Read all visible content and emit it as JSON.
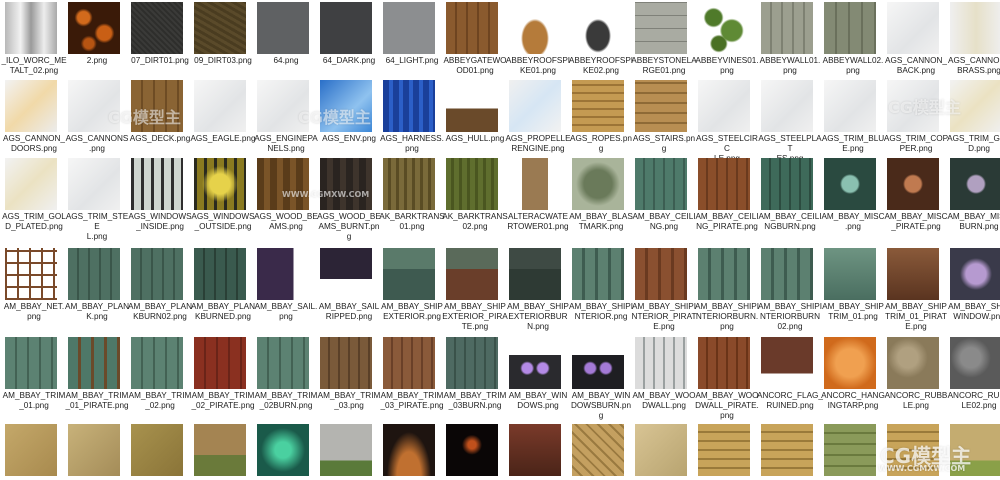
{
  "watermark": {
    "text": "CG模型主",
    "url": "WWW.CGMXW.COM"
  },
  "rows": [
    [
      {
        "label": "_ILO_WORC_ME\nTALT_02.png",
        "tex": "chrome"
      },
      {
        "label": "2.png",
        "tex": "lava"
      },
      {
        "label": "07_DIRT01.png",
        "tex": "darkdirt"
      },
      {
        "label": "09_DIRT03.png",
        "tex": "browndirt"
      },
      {
        "label": "64.png",
        "tex": "gray"
      },
      {
        "label": "64_DARK.png",
        "tex": "darkgray"
      },
      {
        "label": "64_LIGHT.png",
        "tex": "lightgray"
      },
      {
        "label": "ABBEYGATEWO\nOD01.png",
        "tex": "woodgate"
      },
      {
        "label": "ABBEYROOFSPI\nKE01.png",
        "tex": "spike1"
      },
      {
        "label": "ABBEYROOFSPI\nKE02.png",
        "tex": "spike2"
      },
      {
        "label": "ABBEYSTONELA\nRGE01.png",
        "tex": "stone"
      },
      {
        "label": "ABBEYVINES01.\npng",
        "tex": "vines"
      },
      {
        "label": "ABBEYWALL01.\npng",
        "tex": "wall1"
      },
      {
        "label": "ABBEYWALL02.\npng",
        "tex": "wall2"
      },
      {
        "label": "AGS_CANNON_\nBACK.png",
        "tex": "white"
      },
      {
        "label": "AGS_CANNON_\nBRASS.png",
        "tex": "whiteglow"
      }
    ],
    [
      {
        "label": "AGS_CANNON_\nDOORS.png",
        "tex": "whiteorange"
      },
      {
        "label": "AGS_CANNONS\n.png",
        "tex": "white"
      },
      {
        "label": "AGS_DECK.png",
        "tex": "deck"
      },
      {
        "label": "AGS_EAGLE.png",
        "tex": "white"
      },
      {
        "label": "AGS_ENGINEPA\nNELS.png",
        "tex": "white"
      },
      {
        "label": "AGS_ENV.png",
        "tex": "blue"
      },
      {
        "label": "AGS_HARNESS.\npng",
        "tex": "harness"
      },
      {
        "label": "AGS_HULL.png",
        "tex": "hull"
      },
      {
        "label": "AGS_PROPELLE\nRENGINE.png",
        "tex": "whiteblue"
      },
      {
        "label": "AGS_ROPES.pn\ng",
        "tex": "ropes"
      },
      {
        "label": "AGS_STAIRS.pn\ng",
        "tex": "stairs"
      },
      {
        "label": "AGS_STEELCIRC\nLE.png",
        "tex": "white"
      },
      {
        "label": "AGS_STEELPLAT\nES.png",
        "tex": "white"
      },
      {
        "label": "AGS_TRIM_BLU\nE.png",
        "tex": "white"
      },
      {
        "label": "AGS_TRIM_COP\nPER.png",
        "tex": "white"
      },
      {
        "label": "AGS_TRIM_GOL\nD.png",
        "tex": "whitegold"
      }
    ],
    [
      {
        "label": "AGS_TRIM_GOL\nD_PLATED.png",
        "tex": "whitegold"
      },
      {
        "label": "AGS_TRIM_STEE\nL.png",
        "tex": "white"
      },
      {
        "label": "AGS_WINDOWS\n_INSIDE.png",
        "tex": "winInside"
      },
      {
        "label": "AGS_WINDOWS\n_OUTSIDE.png",
        "tex": "winOutside"
      },
      {
        "label": "AGS_WOOD_BE\nAMS.png",
        "tex": "woodbeam"
      },
      {
        "label": "AGS_WOOD_BE\nAMS_BURNT.pn\ng",
        "tex": "woodburnt"
      },
      {
        "label": "AK_BARKTRANS\n01.png",
        "tex": "bark1"
      },
      {
        "label": "AK_BARKTRANS\n02.png",
        "tex": "bark2"
      },
      {
        "label": "ALTERACWATE\nRTOWER01.png",
        "tex": "tower"
      },
      {
        "label": "AM_BBAY_BLAS\nTMARK.png",
        "tex": "blast"
      },
      {
        "label": "AM_BBAY_CEILI\nNG.png",
        "tex": "greenwood"
      },
      {
        "label": "AM_BBAY_CEILI\nNG_PIRATE.png",
        "tex": "redwood"
      },
      {
        "label": "AM_BBAY_CEILI\nNGBURN.png",
        "tex": "greenwooddark"
      },
      {
        "label": "AM_BBAY_MISC\n.png",
        "tex": "misc"
      },
      {
        "label": "AM_BBAY_MISC\n_PIRATE.png",
        "tex": "miscred"
      },
      {
        "label": "AM_BBAY_MISC\nBURN.png",
        "tex": "miscburn"
      }
    ],
    [
      {
        "label": "AM_BBAY_NET.\npng",
        "tex": "net"
      },
      {
        "label": "AM_BBAY_PLAN\nK.png",
        "tex": "greenplank"
      },
      {
        "label": "AM_BBAY_PLAN\nKBURN02.png",
        "tex": "greenplank"
      },
      {
        "label": "AM_BBAY_PLAN\nKBURNED.png",
        "tex": "greenplankdark"
      },
      {
        "label": "AM_BBAY_SAIL.\npng",
        "tex": "sail"
      },
      {
        "label": "AM_BBAY_SAIL\nRIPPED.png",
        "tex": "sailripped"
      },
      {
        "label": "AM_BBAY_SHIP\nEXTERIOR.png",
        "tex": "shipext"
      },
      {
        "label": "AM_BBAY_SHIP\nEXTERIOR_PIRA\nTE.png",
        "tex": "shipextred"
      },
      {
        "label": "AM_BBAY_SHIP\nEXTERIORBUR\nN.png",
        "tex": "shipextburn"
      },
      {
        "label": "AM_BBAY_SHIPI\nNTERIOR.png",
        "tex": "shipint"
      },
      {
        "label": "AM_BBAY_SHIPI\nNTERIOR_PIRAT\nE.png",
        "tex": "shipintred"
      },
      {
        "label": "AM_BBAY_SHIPI\nNTERIORBURN.\npng",
        "tex": "shipint"
      },
      {
        "label": "AM_BBAY_SHIPI\nNTERIORBURN\n02.png",
        "tex": "shipint"
      },
      {
        "label": "AM_BBAY_SHIP\nTRIM_01.png",
        "tex": "shiptrim"
      },
      {
        "label": "AM_BBAY_SHIP\nTRIM_01_PIRAT\nE.png",
        "tex": "shiptrimred"
      },
      {
        "label": "AM_BBAY_SHIP\nWINDOW.png",
        "tex": "shipwindow"
      }
    ],
    [
      {
        "label": "AM_BBAY_TRIM\n_01.png",
        "tex": "trimgreen"
      },
      {
        "label": "AM_BBAY_TRIM\n_01_PIRATE.png",
        "tex": "trimgreen2"
      },
      {
        "label": "AM_BBAY_TRIM\n_02.png",
        "tex": "trimgreen"
      },
      {
        "label": "AM_BBAY_TRIM\n_02_PIRATE.png",
        "tex": "trimred"
      },
      {
        "label": "AM_BBAY_TRIM\n_02BURN.png",
        "tex": "trimgreen"
      },
      {
        "label": "AM_BBAY_TRIM\n_03.png",
        "tex": "trim3"
      },
      {
        "label": "AM_BBAY_TRIM\n_03_PIRATE.png",
        "tex": "trim3red"
      },
      {
        "label": "AM_BBAY_TRIM\n_03BURN.png",
        "tex": "trim3burn"
      },
      {
        "label": "AM_BBAY_WIN\nDOWS.png",
        "tex": "windows"
      },
      {
        "label": "AM_BBAY_WIN\nDOWSBURN.pn\ng",
        "tex": "windowsburn"
      },
      {
        "label": "AM_BBAY_WOO\nDWALL.png",
        "tex": "woodwall"
      },
      {
        "label": "AM_BBAY_WOO\nDWALL_PIRATE.\npng",
        "tex": "woodwallred"
      },
      {
        "label": "ANCORC_FLAG_\nRUINED.png",
        "tex": "flag"
      },
      {
        "label": "ANCORC_HANG\nINGTARP.png",
        "tex": "tarp"
      },
      {
        "label": "ANCORC_RUBB\nLE.png",
        "tex": "rubble"
      },
      {
        "label": "ANCORC_RUBB\nLE02.png",
        "tex": "rubble2"
      }
    ],
    [
      {
        "label": "",
        "tex": "sand"
      },
      {
        "label": "",
        "tex": "sand2"
      },
      {
        "label": "",
        "tex": "sand3"
      },
      {
        "label": "",
        "tex": "dirtgrass"
      },
      {
        "label": "",
        "tex": "teal"
      },
      {
        "label": "",
        "tex": "grassgray"
      },
      {
        "label": "",
        "tex": "blackarch"
      },
      {
        "label": "",
        "tex": "blackfire"
      },
      {
        "label": "",
        "tex": "door"
      },
      {
        "label": "",
        "tex": "tribal"
      },
      {
        "label": "",
        "tex": "sandtile"
      },
      {
        "label": "",
        "tex": "bamboo"
      },
      {
        "label": "",
        "tex": "bamboo"
      },
      {
        "label": "",
        "tex": "mossbrick"
      },
      {
        "label": "",
        "tex": "bamboo"
      },
      {
        "label": "",
        "tex": "sandgreen"
      }
    ]
  ]
}
